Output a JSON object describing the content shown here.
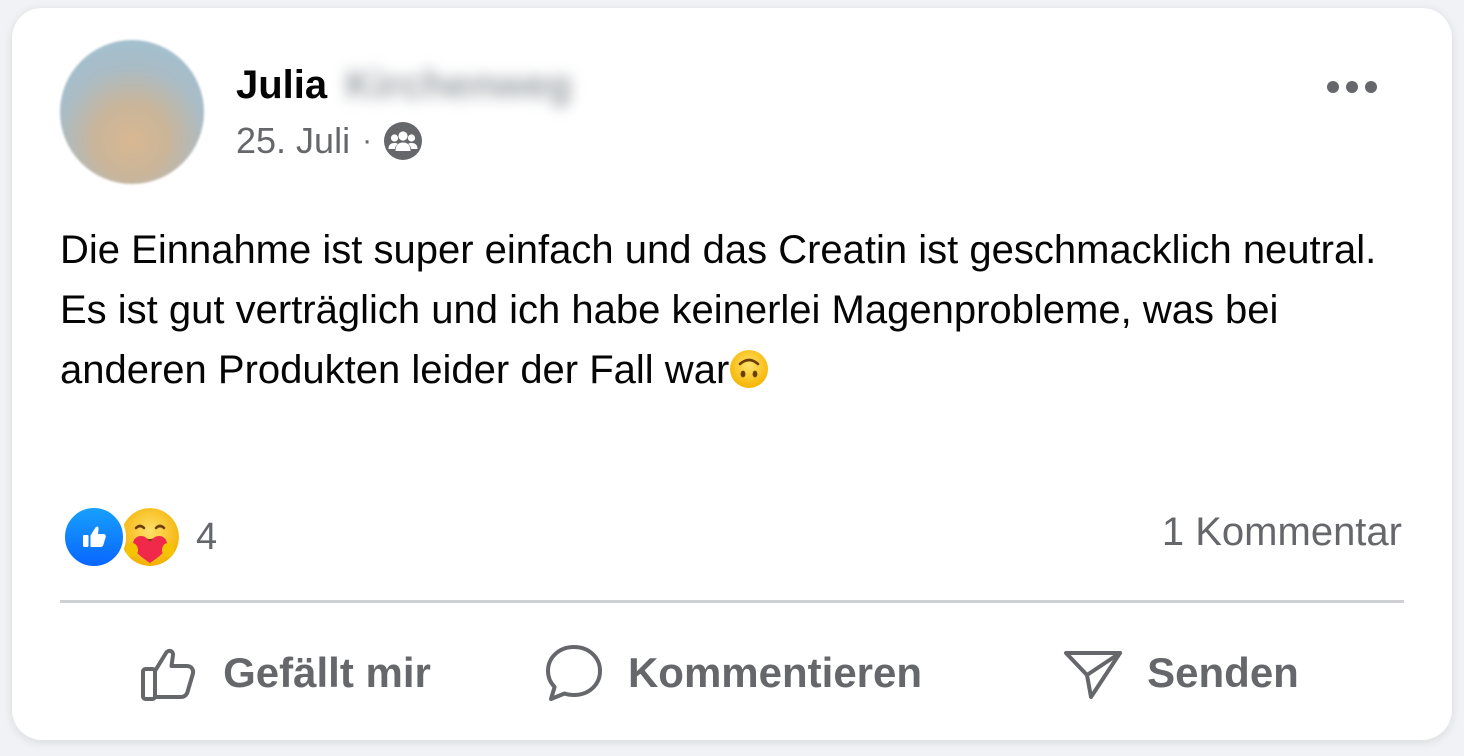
{
  "post": {
    "author_first_name": "Julia",
    "author_surname": "Kirchenweg",
    "date": "25. Juli",
    "separator": "·",
    "audience_icon": "group-icon",
    "more_icon": "more-horizontal-icon",
    "text": "Die Einnahme ist super einfach und das Creatin ist geschmacklich neutral. Es ist gut verträglich und ich habe keinerlei Magenprobleme, was bei anderen Produkten leider der Fall war",
    "text_emoji": "upside-down-face-emoji"
  },
  "reactions": {
    "types": [
      "like",
      "care"
    ],
    "count": "4",
    "comments": "1 Kommentar"
  },
  "actions": {
    "like_label": "Gefällt mir",
    "like_icon": "thumbs-up-icon",
    "comment_label": "Kommentieren",
    "comment_icon": "speech-bubble-icon",
    "share_label": "Senden",
    "share_icon": "send-icon"
  },
  "colors": {
    "text_primary": "#050505",
    "text_secondary": "#65676b",
    "like_blue": "#0866ff",
    "divider": "#ced0d4",
    "card": "#ffffff"
  }
}
